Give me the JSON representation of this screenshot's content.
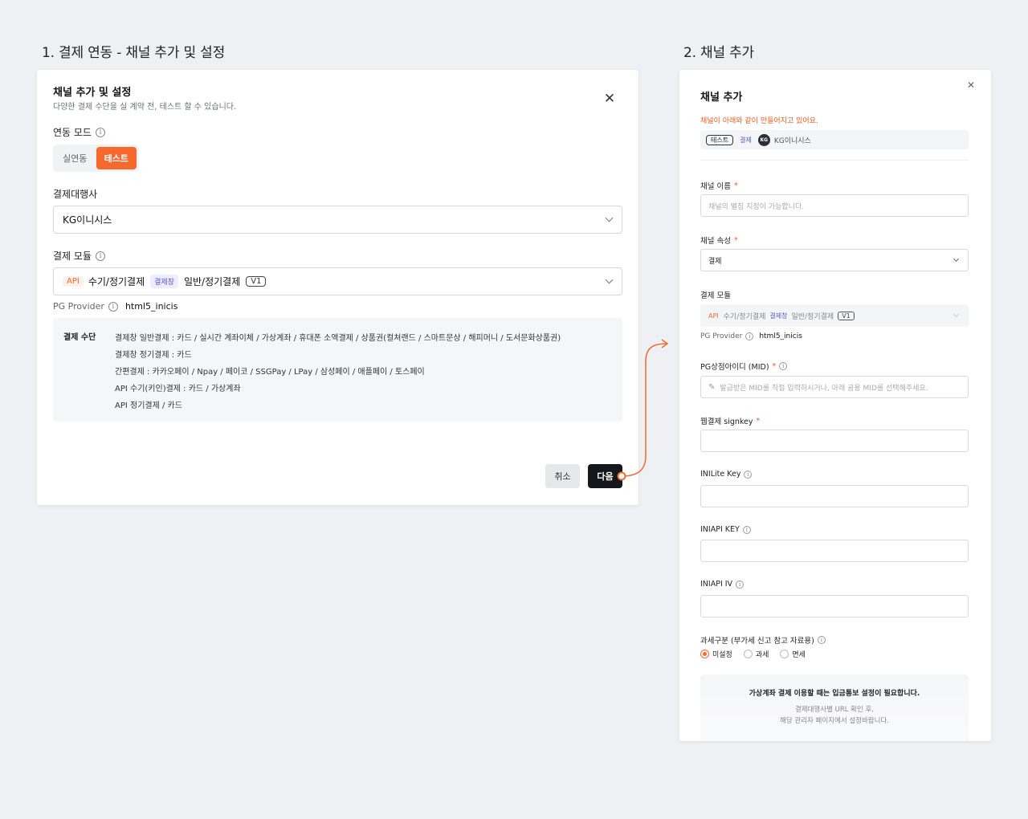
{
  "sections": {
    "left_title": "1. 결제 연동 - 채널 추가 및 설정",
    "right_title": "2. 채널 추가"
  },
  "dialog": {
    "title": "채널 추가 및 설정",
    "subtitle": "다양한 결제 수단을 실 계약 전, 테스트 할 수 있습니다.",
    "mode_label": "연동 모드",
    "modes": {
      "live": "실연동",
      "test": "테스트",
      "selected": "테스트"
    },
    "pg_label": "결제대행사",
    "pg_value": "KG이니시스",
    "module_label": "결제 모듈",
    "module": {
      "api_tag": "API",
      "api_text": "수기/정기결제",
      "window_tag": "결제창",
      "window_text": "일반/정기결제",
      "version": "V1"
    },
    "pg_provider_label": "PG Provider",
    "pg_provider_value": "html5_inicis",
    "payment_methods_label": "결제 수단",
    "payment_methods": [
      "결제창 일반결제 : 카드 / 실시간 계좌이체 / 가상계좌 / 휴대폰 소액결제 / 상품권(컬쳐랜드 / 스마트문상 / 해피머니 / 도서문화상품권)",
      "결제창 정기결제 : 카드",
      "간편결제 : 카카오페이 / Npay / 페이코 / SSGPay / LPay / 삼성페이 / 애플페이 / 토스페이",
      "API 수기(키인)결제 : 카드 / 가상계좌",
      "API 정기결제 / 카드"
    ],
    "cancel_label": "취소",
    "next_label": "다음"
  },
  "panel": {
    "title": "채널 추가",
    "notice": "채널이 아래와 같이 만들어지고 있어요.",
    "preview": {
      "test_tag": "테스트",
      "pay_tag": "결제",
      "logo": "KG",
      "name": "KG이니시스"
    },
    "channel_name_label": "채널 이름",
    "channel_name_placeholder": "채널의 별칭 지정이 가능합니다.",
    "channel_attr_label": "채널 속성",
    "channel_attr_value": "결제",
    "module_label": "결제 모듈",
    "module": {
      "api_tag": "API",
      "api_text": "수기/정기결제",
      "window_tag": "결제창",
      "window_text": "일반/정기결제",
      "version": "V1"
    },
    "pg_provider_label": "PG Provider",
    "pg_provider_value": "html5_inicis",
    "mid_label": "PG상점아이디 (MID)",
    "mid_placeholder": "발급받은 MID를 직접 입력하시거나, 아래 공용 MID를 선택해주세요.",
    "signkey_label": "웹결제 signkey",
    "inilite_label": "INILite Key",
    "iniapi_key_label": "INIAPI KEY",
    "iniapi_iv_label": "INIAPI IV",
    "tax_label": "과세구분 (부가세 신고 참고 자료용)",
    "tax_options": [
      "미설정",
      "과세",
      "면세"
    ],
    "tax_selected": "미설정",
    "vaccount_title": "가상계좌 결제 이용할 때는 입금통보 설정이 필요합니다.",
    "vaccount_line1": "결제대행사별 URL 확인 후,",
    "vaccount_line2": "해당 관리자 페이지에서 설정바랍니다."
  },
  "colors": {
    "accent": "#f7682d",
    "dark_button": "#15171c",
    "window_tag": "#5c55cf"
  }
}
